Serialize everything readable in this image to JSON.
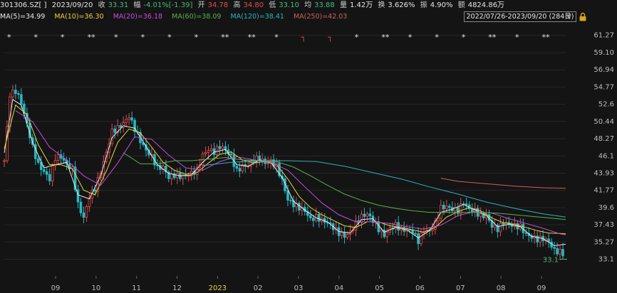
{
  "header": {
    "code": "301306.SZ[ ]",
    "date": "2023/09/20",
    "close_label": "收",
    "close": "33.31",
    "change_label": "幅",
    "change": "-4.01%[-1.39]",
    "open_label": "开",
    "open": "34.78",
    "high_label": "高",
    "high": "34.80",
    "low_label": "低",
    "low": "33.10",
    "avg_label": "均",
    "avg": "33.88",
    "volume_label": "量",
    "volume": "1.42万",
    "turnover_label": "换",
    "turnover": "3.626%",
    "amplitude_label": "振",
    "amplitude": "4.90%",
    "amount_label": "额",
    "amount": "4824.86万"
  },
  "ma_bar": {
    "ma5": "MA(5)=34.99",
    "ma10": "MA(10)=36.30",
    "ma20": "MA(20)=36.18",
    "ma60": "MA(60)=38.09",
    "ma120": "MA(120)=38.41",
    "ma250": "MA(250)=42.03"
  },
  "range": {
    "text": "2022/07/26-2023/09/20 (284日)",
    "arrow_icon": "triangle-down-icon",
    "lock_icon": "lock-icon"
  },
  "colors": {
    "up": "#e24c4c",
    "down": "#27b7c2",
    "ma5": "#e9e9e9",
    "ma10": "#e6d33d",
    "ma20": "#c54ee0",
    "ma60": "#58b04a",
    "ma120": "#2eb2bd",
    "ma250": "#c9605e",
    "grid": "#262626",
    "last_price": "#3fbf7a"
  },
  "chart_data": {
    "type": "candlestick",
    "y_ticks": [
      "61.27",
      "59.10",
      "56.94",
      "54.77",
      "52.6",
      "50.44",
      "48.27",
      "46.1",
      "43.93",
      "41.77",
      "39.6",
      "37.43",
      "35.27",
      "33.1"
    ],
    "y_range": [
      31.0,
      62.5
    ],
    "x_ticks": [
      "09",
      "10",
      "11",
      "12",
      "2023",
      "02",
      "03",
      "04",
      "05",
      "06",
      "07",
      "08",
      "09"
    ],
    "last_price_label": "33.1",
    "markers": [
      "*",
      "*",
      "*",
      "**",
      "*",
      "*",
      "*",
      "*",
      "**",
      "**",
      "*",
      "┐",
      "┐",
      "*",
      "**",
      "*",
      "*",
      "*",
      "**",
      "*",
      "**"
    ],
    "price_path": [
      [
        0,
        45.5
      ],
      [
        2,
        53.8
      ],
      [
        4,
        54.3
      ],
      [
        6,
        52.8
      ],
      [
        8,
        50.1
      ],
      [
        10,
        47.2
      ],
      [
        12,
        45.0
      ],
      [
        14,
        44.1
      ],
      [
        16,
        43.2
      ],
      [
        18,
        45.9
      ],
      [
        20,
        46.0
      ],
      [
        22,
        45.0
      ],
      [
        24,
        44.4
      ],
      [
        26,
        40.0
      ],
      [
        28,
        38.3
      ],
      [
        30,
        41.0
      ],
      [
        32,
        42.0
      ],
      [
        34,
        44.1
      ],
      [
        36,
        46.5
      ],
      [
        38,
        49.2
      ],
      [
        40,
        49.6
      ],
      [
        42,
        50.2
      ],
      [
        44,
        51.1
      ],
      [
        46,
        49.5
      ],
      [
        48,
        48.0
      ],
      [
        50,
        46.8
      ],
      [
        52,
        46.0
      ],
      [
        54,
        44.6
      ],
      [
        56,
        44.7
      ],
      [
        58,
        43.4
      ],
      [
        60,
        43.7
      ],
      [
        62,
        43.5
      ],
      [
        64,
        43.6
      ],
      [
        66,
        43.9
      ],
      [
        68,
        44.3
      ],
      [
        70,
        46.2
      ],
      [
        72,
        46.9
      ],
      [
        74,
        46.6
      ],
      [
        76,
        47.3
      ],
      [
        78,
        46.9
      ],
      [
        80,
        46.0
      ],
      [
        82,
        44.2
      ],
      [
        84,
        44.8
      ],
      [
        86,
        44.9
      ],
      [
        88,
        45.7
      ],
      [
        90,
        45.8
      ],
      [
        92,
        45.2
      ],
      [
        94,
        45.4
      ],
      [
        96,
        44.8
      ],
      [
        98,
        43.0
      ],
      [
        100,
        40.6
      ],
      [
        102,
        40.0
      ],
      [
        104,
        39.6
      ],
      [
        106,
        39.2
      ],
      [
        108,
        38.1
      ],
      [
        110,
        38.4
      ],
      [
        112,
        38.0
      ],
      [
        114,
        37.7
      ],
      [
        116,
        37.1
      ],
      [
        118,
        36.4
      ],
      [
        120,
        36.0
      ],
      [
        122,
        36.5
      ],
      [
        124,
        37.6
      ],
      [
        126,
        38.5
      ],
      [
        128,
        38.8
      ],
      [
        130,
        38.0
      ],
      [
        132,
        36.9
      ],
      [
        134,
        36.1
      ],
      [
        136,
        36.9
      ],
      [
        138,
        37.4
      ],
      [
        140,
        36.8
      ],
      [
        142,
        36.8
      ],
      [
        144,
        36.6
      ],
      [
        146,
        35.4
      ],
      [
        148,
        36.8
      ],
      [
        150,
        36.6
      ],
      [
        152,
        37.6
      ],
      [
        154,
        39.6
      ],
      [
        156,
        39.7
      ],
      [
        158,
        39.4
      ],
      [
        160,
        39.2
      ],
      [
        162,
        40.3
      ],
      [
        164,
        39.4
      ],
      [
        166,
        39.2
      ],
      [
        168,
        38.5
      ],
      [
        170,
        38.6
      ],
      [
        172,
        37.3
      ],
      [
        174,
        36.9
      ],
      [
        176,
        37.7
      ],
      [
        178,
        37.5
      ],
      [
        180,
        37.3
      ],
      [
        182,
        37.2
      ],
      [
        184,
        36.2
      ],
      [
        186,
        35.9
      ],
      [
        188,
        35.6
      ],
      [
        190,
        35.7
      ],
      [
        192,
        35.3
      ],
      [
        194,
        34.2
      ],
      [
        196,
        34.0
      ],
      [
        198,
        33.6
      ]
    ],
    "series": [
      {
        "name": "MA(5)",
        "path": [
          [
            0,
            46.5
          ],
          [
            3,
            53.2
          ],
          [
            6,
            52.5
          ],
          [
            10,
            47.8
          ],
          [
            14,
            44.6
          ],
          [
            18,
            45.0
          ],
          [
            22,
            45.3
          ],
          [
            26,
            41.2
          ],
          [
            30,
            40.7
          ],
          [
            34,
            43.6
          ],
          [
            38,
            48.4
          ],
          [
            42,
            49.9
          ],
          [
            46,
            49.6
          ],
          [
            50,
            47.3
          ],
          [
            54,
            45.0
          ],
          [
            58,
            43.9
          ],
          [
            62,
            43.6
          ],
          [
            66,
            43.7
          ],
          [
            70,
            45.3
          ],
          [
            74,
            46.6
          ],
          [
            78,
            46.9
          ],
          [
            82,
            45.0
          ],
          [
            86,
            44.8
          ],
          [
            90,
            45.6
          ],
          [
            94,
            45.3
          ],
          [
            98,
            43.4
          ],
          [
            102,
            40.4
          ],
          [
            106,
            39.3
          ],
          [
            110,
            38.3
          ],
          [
            114,
            37.8
          ],
          [
            118,
            36.6
          ],
          [
            122,
            36.4
          ],
          [
            126,
            38.1
          ],
          [
            130,
            38.2
          ],
          [
            134,
            36.5
          ],
          [
            138,
            37.1
          ],
          [
            142,
            36.8
          ],
          [
            146,
            35.8
          ],
          [
            150,
            36.7
          ],
          [
            154,
            39.0
          ],
          [
            158,
            39.4
          ],
          [
            162,
            40.0
          ],
          [
            166,
            39.3
          ],
          [
            170,
            38.6
          ],
          [
            174,
            37.2
          ],
          [
            178,
            37.5
          ],
          [
            182,
            37.2
          ],
          [
            186,
            36.0
          ],
          [
            190,
            35.7
          ],
          [
            194,
            34.8
          ],
          [
            198,
            34.99
          ]
        ]
      },
      {
        "name": "MA(10)",
        "path": [
          [
            0,
            47.0
          ],
          [
            4,
            52.5
          ],
          [
            8,
            51.3
          ],
          [
            12,
            47.5
          ],
          [
            16,
            45.0
          ],
          [
            20,
            45.0
          ],
          [
            24,
            44.5
          ],
          [
            28,
            41.8
          ],
          [
            32,
            41.2
          ],
          [
            36,
            44.2
          ],
          [
            40,
            47.8
          ],
          [
            44,
            49.5
          ],
          [
            48,
            49.0
          ],
          [
            52,
            47.2
          ],
          [
            56,
            45.3
          ],
          [
            60,
            44.3
          ],
          [
            64,
            43.8
          ],
          [
            68,
            44.0
          ],
          [
            72,
            45.2
          ],
          [
            76,
            46.3
          ],
          [
            80,
            46.6
          ],
          [
            84,
            45.6
          ],
          [
            88,
            45.2
          ],
          [
            92,
            45.4
          ],
          [
            96,
            45.0
          ],
          [
            100,
            43.2
          ],
          [
            104,
            41.0
          ],
          [
            108,
            39.6
          ],
          [
            112,
            38.7
          ],
          [
            116,
            38.0
          ],
          [
            120,
            37.3
          ],
          [
            124,
            37.1
          ],
          [
            128,
            37.8
          ],
          [
            132,
            37.8
          ],
          [
            136,
            37.3
          ],
          [
            140,
            37.1
          ],
          [
            144,
            36.8
          ],
          [
            148,
            36.5
          ],
          [
            152,
            37.1
          ],
          [
            156,
            38.4
          ],
          [
            160,
            39.1
          ],
          [
            164,
            39.6
          ],
          [
            168,
            39.2
          ],
          [
            172,
            38.3
          ],
          [
            176,
            37.7
          ],
          [
            180,
            37.5
          ],
          [
            184,
            37.1
          ],
          [
            188,
            36.7
          ],
          [
            192,
            36.4
          ],
          [
            196,
            36.35
          ],
          [
            198,
            36.3
          ]
        ]
      },
      {
        "name": "MA(20)",
        "path": [
          [
            4,
            51.8
          ],
          [
            10,
            50.4
          ],
          [
            16,
            47.2
          ],
          [
            22,
            45.6
          ],
          [
            28,
            43.6
          ],
          [
            34,
            42.4
          ],
          [
            40,
            45.2
          ],
          [
            46,
            48.5
          ],
          [
            52,
            48.2
          ],
          [
            58,
            46.2
          ],
          [
            64,
            44.6
          ],
          [
            70,
            44.3
          ],
          [
            76,
            45.4
          ],
          [
            82,
            46.0
          ],
          [
            88,
            45.6
          ],
          [
            94,
            45.3
          ],
          [
            100,
            44.3
          ],
          [
            106,
            42.2
          ],
          [
            112,
            40.2
          ],
          [
            118,
            38.7
          ],
          [
            124,
            37.8
          ],
          [
            130,
            37.8
          ],
          [
            136,
            37.6
          ],
          [
            142,
            37.2
          ],
          [
            148,
            36.9
          ],
          [
            154,
            37.4
          ],
          [
            160,
            38.6
          ],
          [
            166,
            39.1
          ],
          [
            172,
            38.9
          ],
          [
            178,
            38.2
          ],
          [
            184,
            37.6
          ],
          [
            190,
            37.0
          ],
          [
            196,
            36.3
          ],
          [
            198,
            36.18
          ]
        ]
      },
      {
        "name": "MA(60)",
        "path": [
          [
            42,
            46.5
          ],
          [
            48,
            45.1
          ],
          [
            54,
            45.1
          ],
          [
            60,
            45.5
          ],
          [
            66,
            45.5
          ],
          [
            72,
            45.7
          ],
          [
            78,
            45.9
          ],
          [
            84,
            45.6
          ],
          [
            90,
            45.5
          ],
          [
            96,
            45.4
          ],
          [
            102,
            44.7
          ],
          [
            108,
            43.6
          ],
          [
            114,
            42.4
          ],
          [
            120,
            41.3
          ],
          [
            126,
            40.5
          ],
          [
            132,
            39.9
          ],
          [
            138,
            39.5
          ],
          [
            144,
            39.2
          ],
          [
            150,
            39.0
          ],
          [
            156,
            39.0
          ],
          [
            162,
            39.0
          ],
          [
            168,
            39.0
          ],
          [
            174,
            38.9
          ],
          [
            180,
            38.7
          ],
          [
            186,
            38.5
          ],
          [
            192,
            38.3
          ],
          [
            198,
            38.09
          ]
        ]
      },
      {
        "name": "MA(120)",
        "path": [
          [
            70,
            44.9
          ],
          [
            80,
            45.3
          ],
          [
            90,
            45.5
          ],
          [
            100,
            45.5
          ],
          [
            110,
            45.4
          ],
          [
            120,
            44.8
          ],
          [
            130,
            44.0
          ],
          [
            140,
            43.2
          ],
          [
            150,
            42.2
          ],
          [
            160,
            41.3
          ],
          [
            170,
            40.3
          ],
          [
            180,
            39.5
          ],
          [
            190,
            38.8
          ],
          [
            198,
            38.41
          ]
        ]
      },
      {
        "name": "MA(250)",
        "path": [
          [
            154,
            43.3
          ],
          [
            160,
            42.9
          ],
          [
            170,
            42.6
          ],
          [
            180,
            42.3
          ],
          [
            190,
            42.1
          ],
          [
            198,
            42.03
          ]
        ]
      }
    ]
  }
}
